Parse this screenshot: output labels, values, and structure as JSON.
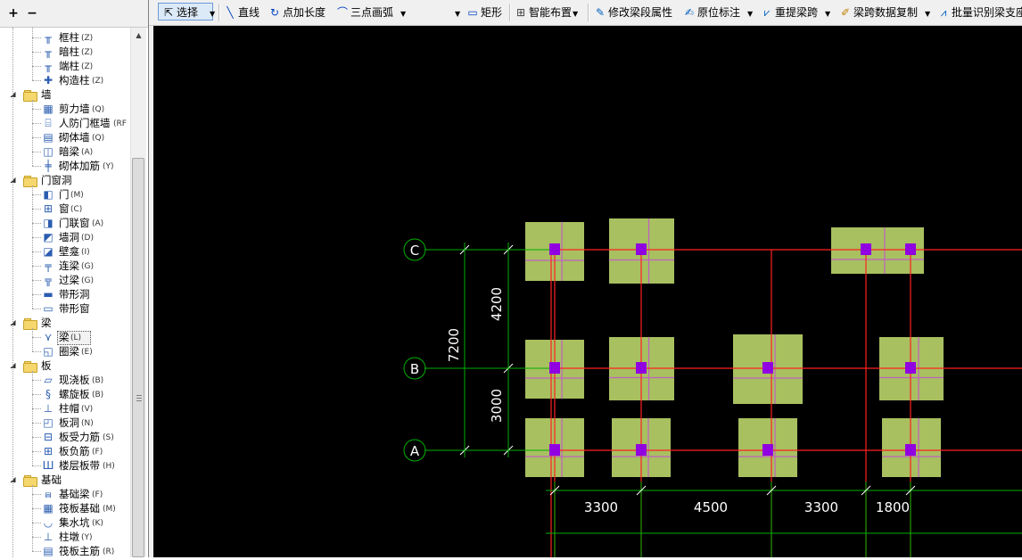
{
  "left_toolbar": {
    "expand_all": "+",
    "collapse_all": "−"
  },
  "tree": {
    "rows": [
      {
        "type": "item",
        "icon": "column-icon",
        "label": "框柱",
        "hot": "(Z)"
      },
      {
        "type": "item",
        "icon": "column-icon",
        "label": "暗柱",
        "hot": "(Z)"
      },
      {
        "type": "item",
        "icon": "column-icon",
        "label": "端柱",
        "hot": "(Z)"
      },
      {
        "type": "item",
        "icon": "construction-column-icon",
        "label": "构造柱",
        "hot": "(Z)"
      },
      {
        "type": "folder",
        "label": "墙"
      },
      {
        "type": "item",
        "icon": "shear-wall-icon",
        "label": "剪力墙",
        "hot": "(Q)"
      },
      {
        "type": "item",
        "icon": "civil-defense-door-icon",
        "label": "人防门框墙",
        "hot": "(RF"
      },
      {
        "type": "item",
        "icon": "masonry-wall-icon",
        "label": "砌体墙",
        "hot": "(Q)"
      },
      {
        "type": "item",
        "icon": "hidden-beam-icon",
        "label": "暗梁",
        "hot": "(A)"
      },
      {
        "type": "item",
        "icon": "masonry-rebar-icon",
        "label": "砌体加筋",
        "hot": "(Y)"
      },
      {
        "type": "folder",
        "label": "门窗洞"
      },
      {
        "type": "item",
        "icon": "door-icon",
        "label": "门",
        "hot": "(M)"
      },
      {
        "type": "item",
        "icon": "window-icon",
        "label": "窗",
        "hot": "(C)"
      },
      {
        "type": "item",
        "icon": "door-window-icon",
        "label": "门联窗",
        "hot": "(A)"
      },
      {
        "type": "item",
        "icon": "wall-opening-icon",
        "label": "墙洞",
        "hot": "(D)"
      },
      {
        "type": "item",
        "icon": "niche-icon",
        "label": "壁龛",
        "hot": "(I)"
      },
      {
        "type": "item",
        "icon": "coupling-beam-icon",
        "label": "连梁",
        "hot": "(G)"
      },
      {
        "type": "item",
        "icon": "lintel-icon",
        "label": "过梁",
        "hot": "(G)"
      },
      {
        "type": "item",
        "icon": "strip-opening-icon",
        "label": "带形洞",
        "hot": ""
      },
      {
        "type": "item",
        "icon": "strip-window-icon",
        "label": "带形窗",
        "hot": ""
      },
      {
        "type": "folder",
        "label": "梁"
      },
      {
        "type": "item",
        "icon": "beam-icon",
        "label": "梁",
        "hot": "(L)",
        "selected": true
      },
      {
        "type": "item",
        "icon": "ring-beam-icon",
        "label": "圈梁",
        "hot": "(E)"
      },
      {
        "type": "folder",
        "label": "板"
      },
      {
        "type": "item",
        "icon": "cast-slab-icon",
        "label": "现浇板",
        "hot": "(B)"
      },
      {
        "type": "item",
        "icon": "spiral-slab-icon",
        "label": "螺旋板",
        "hot": "(B)"
      },
      {
        "type": "item",
        "icon": "column-cap-icon",
        "label": "柱帽",
        "hot": "(V)"
      },
      {
        "type": "item",
        "icon": "slab-hole-icon",
        "label": "板洞",
        "hot": "(N)"
      },
      {
        "type": "item",
        "icon": "slab-rebar-icon",
        "label": "板受力筋",
        "hot": "(S)"
      },
      {
        "type": "item",
        "icon": "slab-neg-rebar-icon",
        "label": "板负筋",
        "hot": "(F)"
      },
      {
        "type": "item",
        "icon": "floor-band-icon",
        "label": "楼层板带",
        "hot": "(H)"
      },
      {
        "type": "folder",
        "label": "基础"
      },
      {
        "type": "item",
        "icon": "foundation-beam-icon",
        "label": "基础梁",
        "hot": "(F)"
      },
      {
        "type": "item",
        "icon": "raft-foundation-icon",
        "label": "筏板基础",
        "hot": "(M)"
      },
      {
        "type": "item",
        "icon": "sump-pit-icon",
        "label": "集水坑",
        "hot": "(K)"
      },
      {
        "type": "item",
        "icon": "pier-icon",
        "label": "柱墩",
        "hot": "(Y)"
      },
      {
        "type": "item",
        "icon": "raft-rebar-icon",
        "label": "筏板主筋",
        "hot": "(R)"
      }
    ]
  },
  "toolbar": {
    "select": "选择",
    "line": "直线",
    "point_length": "点加长度",
    "three_point_arc": "三点画弧",
    "rect": "矩形",
    "smart_place": "智能布置",
    "modify_segment": "修改梁段属性",
    "in_situ_label": "原位标注",
    "re_extract_span": "重提梁跨",
    "copy_span_data": "梁跨数据复制",
    "batch_identify": "批量识别梁支座"
  },
  "drawing": {
    "axes": [
      {
        "label": "C"
      },
      {
        "label": "B"
      },
      {
        "label": "A"
      }
    ],
    "vertical_dims": {
      "total": "7200",
      "upper": "4200",
      "lower": "3000"
    },
    "horizontal_dims": [
      "3300",
      "4500",
      "3300",
      "1800"
    ],
    "colors": {
      "background": "#000000",
      "axis_line": "#00b000",
      "beam_line": "#ff2020",
      "footing": "#a8c060",
      "footing_cross": "#c060c0",
      "column": "#9000e0",
      "dim_text": "#ffffff"
    }
  }
}
